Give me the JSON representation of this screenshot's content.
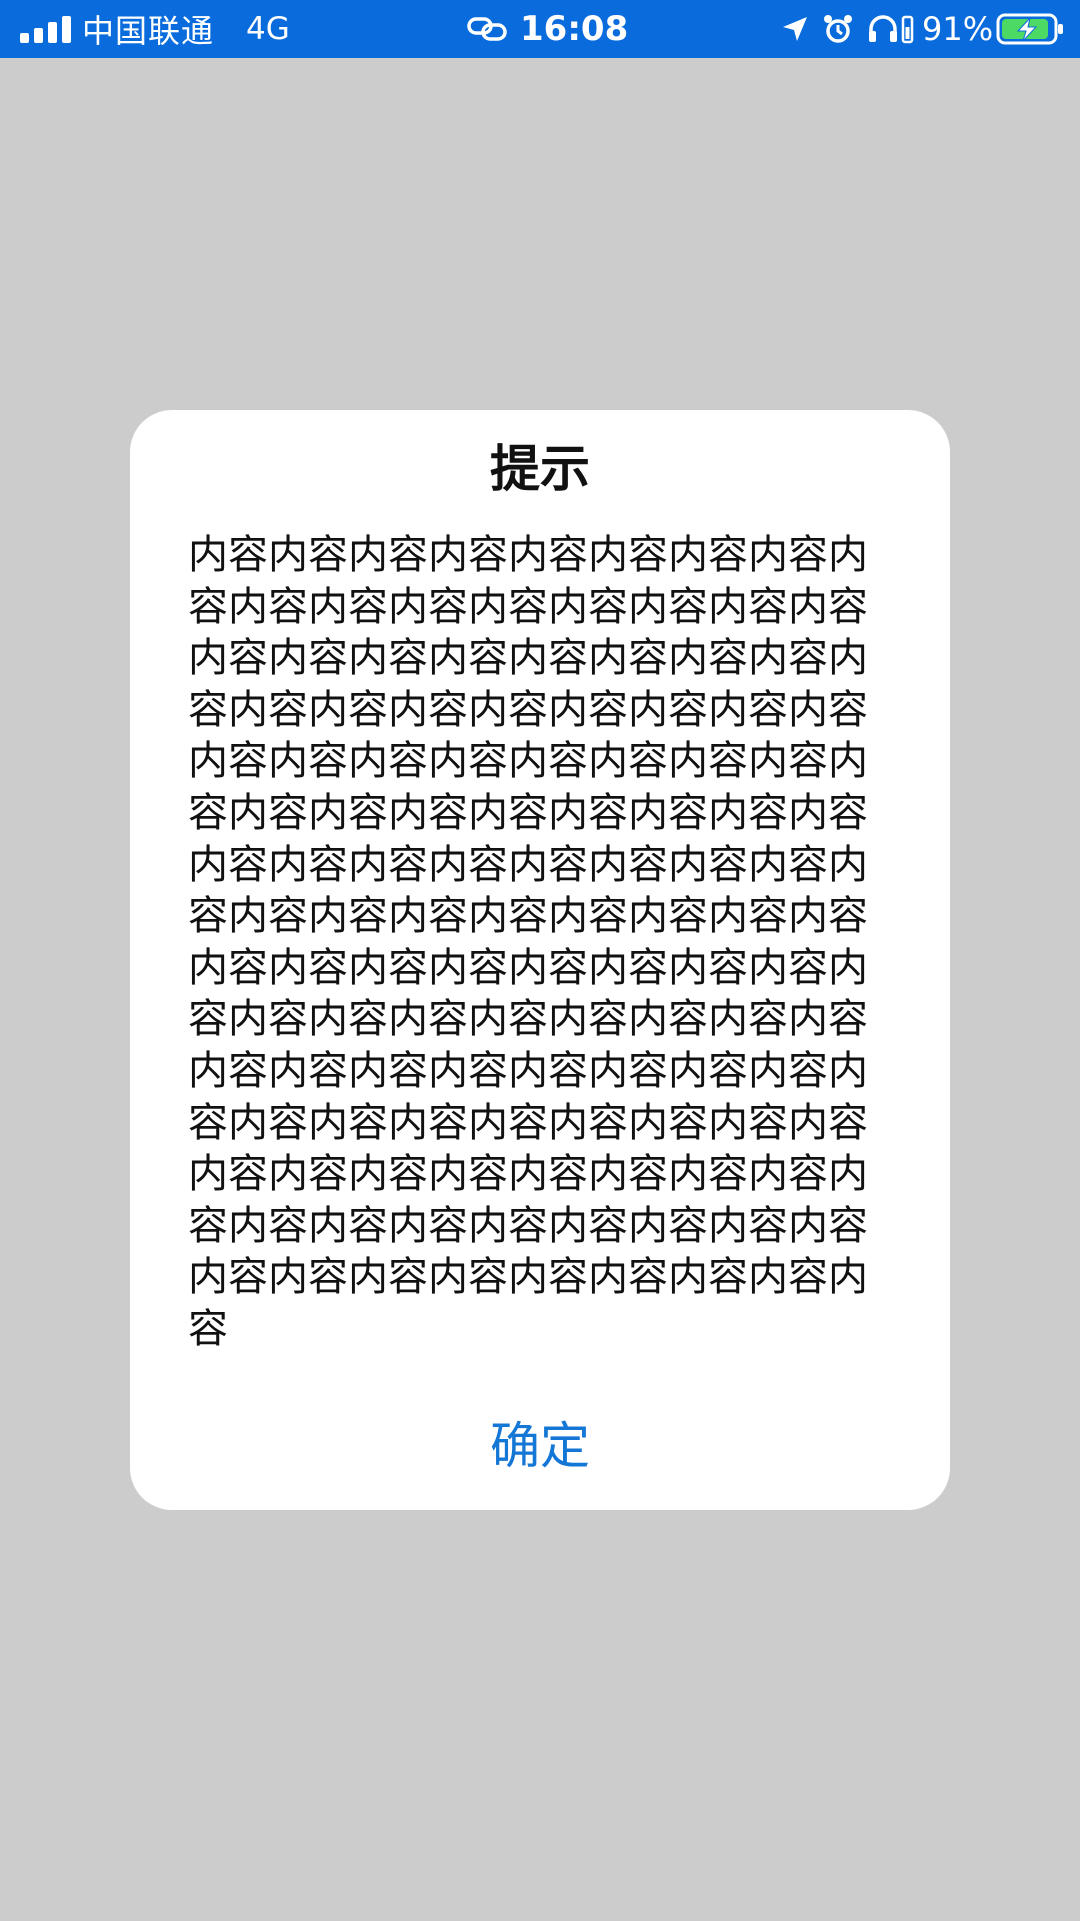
{
  "status_bar": {
    "carrier": "中国联通",
    "network": "4G",
    "time": "16:08",
    "battery_percent": "91%",
    "background_color": "#0a6cdc",
    "icons": [
      "signal-icon",
      "link-icon",
      "location-icon",
      "alarm-icon",
      "headphone-icon",
      "battery-charging-icon"
    ]
  },
  "dialog": {
    "title": "提示",
    "content": "内容内容内容内容内容内容内容内容内容内容内容内容内容内容内容内容内容内容内容内容内容内容内容内容内容内容内容内容内容内容内容内容内容内容内容内容内容内容内容内容内容内容内容内容内容内容内容内容内容内容内容内容内容内容内容内容内容内容内容内容内容内容内容内容内容内容内容内容内容内容内容内容内容内容内容内容内容内容内容内容内容内容内容内容内容内容内容内容内容内容内容内容内容内容内容内容内容内容内容内容内容内容内容内容内容内容内容内容内容内容内容内容内容内容内容内容内容内容内容内容内容内容内容内容内容内容内容内容",
    "confirm_label": "确定"
  },
  "colors": {
    "overlay": "#cccccc",
    "dialog_background": "#ffffff",
    "accent": "#1477d6"
  }
}
